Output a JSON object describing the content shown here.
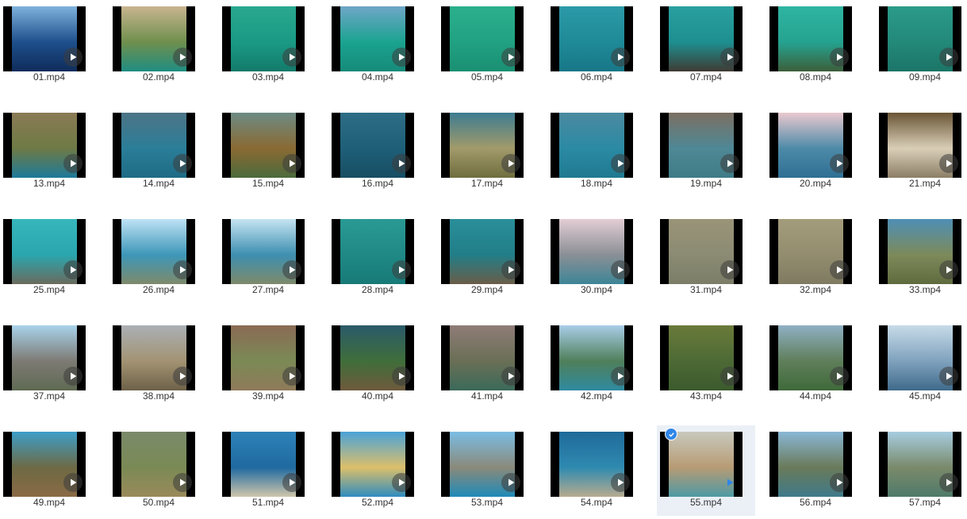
{
  "files": [
    {
      "name": "01.mp4",
      "colors": [
        "#7fb2dc",
        "#1e4f8c",
        "#0f2c5a"
      ]
    },
    {
      "name": "02.mp4",
      "colors": [
        "#c9b590",
        "#6f8f4d",
        "#1f8e82"
      ]
    },
    {
      "name": "03.mp4",
      "colors": [
        "#2aa88e",
        "#1a9a85",
        "#137a6a"
      ]
    },
    {
      "name": "04.mp4",
      "colors": [
        "#6fa6c8",
        "#1ba390",
        "#168a79"
      ]
    },
    {
      "name": "05.mp4",
      "colors": [
        "#2bb08d",
        "#21a282",
        "#1a8f72"
      ]
    },
    {
      "name": "06.mp4",
      "colors": [
        "#2c9aa8",
        "#1f8a98",
        "#177787"
      ]
    },
    {
      "name": "07.mp4",
      "colors": [
        "#2aa0a0",
        "#1d8f90",
        "#3f3a33"
      ]
    },
    {
      "name": "08.mp4",
      "colors": [
        "#2fb5a2",
        "#24a390",
        "#3c5e3a"
      ]
    },
    {
      "name": "09.mp4",
      "colors": [
        "#2b9b89",
        "#23897a",
        "#1b7567"
      ]
    },
    {
      "name": "13.mp4",
      "colors": [
        "#8a7a55",
        "#6e7a45",
        "#1d7a9a"
      ]
    },
    {
      "name": "14.mp4",
      "colors": [
        "#4d7486",
        "#2b7e98",
        "#1e6b85"
      ]
    },
    {
      "name": "15.mp4",
      "colors": [
        "#6d8b83",
        "#8a6a33",
        "#4c6a3c"
      ]
    },
    {
      "name": "16.mp4",
      "colors": [
        "#2e6d86",
        "#1e5f78",
        "#174e63"
      ]
    },
    {
      "name": "17.mp4",
      "colors": [
        "#3d7c90",
        "#a29a6a",
        "#6f6d3e"
      ]
    },
    {
      "name": "18.mp4",
      "colors": [
        "#4b8aa0",
        "#2b8aa4",
        "#1f7a90"
      ]
    },
    {
      "name": "19.mp4",
      "colors": [
        "#7b6f62",
        "#4f8896",
        "#3f7b87"
      ]
    },
    {
      "name": "20.mp4",
      "colors": [
        "#e9c9cf",
        "#4d8aa8",
        "#2f6f93"
      ]
    },
    {
      "name": "21.mp4",
      "colors": [
        "#6a5535",
        "#d9cfb8",
        "#8c7e66"
      ]
    },
    {
      "name": "25.mp4",
      "colors": [
        "#37b6bc",
        "#2aa6ae",
        "#6a6a5d"
      ]
    },
    {
      "name": "26.mp4",
      "colors": [
        "#bfe2f5",
        "#3d97b8",
        "#7e8a6a"
      ]
    },
    {
      "name": "27.mp4",
      "colors": [
        "#c6e4f2",
        "#3d8fb0",
        "#7e8a6a"
      ]
    },
    {
      "name": "28.mp4",
      "colors": [
        "#2a9a95",
        "#208985",
        "#177a77"
      ]
    },
    {
      "name": "29.mp4",
      "colors": [
        "#2a8f9a",
        "#217e88",
        "#6a5d48"
      ]
    },
    {
      "name": "30.mp4",
      "colors": [
        "#e3cdd5",
        "#8a8f95",
        "#3d8596"
      ]
    },
    {
      "name": "31.mp4",
      "colors": [
        "#9a9478",
        "#8b8b73",
        "#7c7d68"
      ]
    },
    {
      "name": "32.mp4",
      "colors": [
        "#a39c7b",
        "#938d6f",
        "#7f7a61"
      ]
    },
    {
      "name": "33.mp4",
      "colors": [
        "#4e8fb5",
        "#7d8a5a",
        "#5f6b3e"
      ]
    },
    {
      "name": "37.mp4",
      "colors": [
        "#a8d3ea",
        "#7d7a74",
        "#5e6a52"
      ]
    },
    {
      "name": "38.mp4",
      "colors": [
        "#aab0b5",
        "#a39373",
        "#6d6148"
      ]
    },
    {
      "name": "39.mp4",
      "colors": [
        "#8a6a55",
        "#7b8a55",
        "#8f7a5a"
      ]
    },
    {
      "name": "40.mp4",
      "colors": [
        "#2a5a6a",
        "#3f6e3a",
        "#6f5a3d"
      ]
    },
    {
      "name": "41.mp4",
      "colors": [
        "#8f7c78",
        "#6a6f55",
        "#3b6a5a"
      ]
    },
    {
      "name": "42.mp4",
      "colors": [
        "#a9cde8",
        "#4f7f5a",
        "#2f8aa0"
      ]
    },
    {
      "name": "43.mp4",
      "colors": [
        "#6a7a3a",
        "#4d6a35",
        "#3b5a2d"
      ]
    },
    {
      "name": "44.mp4",
      "colors": [
        "#8fb0c4",
        "#5f7e5a",
        "#3f6a3a"
      ]
    },
    {
      "name": "45.mp4",
      "colors": [
        "#c7dbe8",
        "#7fa2bd",
        "#3f6a8a"
      ]
    },
    {
      "name": "49.mp4",
      "colors": [
        "#3d9ec8",
        "#6d6a44",
        "#8a6a45"
      ]
    },
    {
      "name": "50.mp4",
      "colors": [
        "#7a8a6a",
        "#7a8a55",
        "#9a8a5a"
      ]
    },
    {
      "name": "51.mp4",
      "colors": [
        "#2d82b8",
        "#1f6aa0",
        "#cfc6aa"
      ]
    },
    {
      "name": "52.mp4",
      "colors": [
        "#4aa2d8",
        "#dcbf6a",
        "#2f8cbf"
      ]
    },
    {
      "name": "53.mp4",
      "colors": [
        "#7bbde4",
        "#8a8a7a",
        "#1f8ab8"
      ]
    },
    {
      "name": "54.mp4",
      "colors": [
        "#1f6a9a",
        "#2f8ab0",
        "#b7ab8f"
      ]
    },
    {
      "name": "55.mp4",
      "colors": [
        "#c8c9bd",
        "#b79b74",
        "#4d9aa5"
      ],
      "selected": true
    },
    {
      "name": "56.mp4",
      "colors": [
        "#8ab8d5",
        "#6a7a5a",
        "#3f7a8a"
      ]
    },
    {
      "name": "57.mp4",
      "colors": [
        "#a6cde0",
        "#7a8a6a",
        "#4f7a6a"
      ]
    }
  ],
  "icons": {
    "play": "play-icon",
    "check": "check-icon"
  },
  "accent": "#2f86e8"
}
